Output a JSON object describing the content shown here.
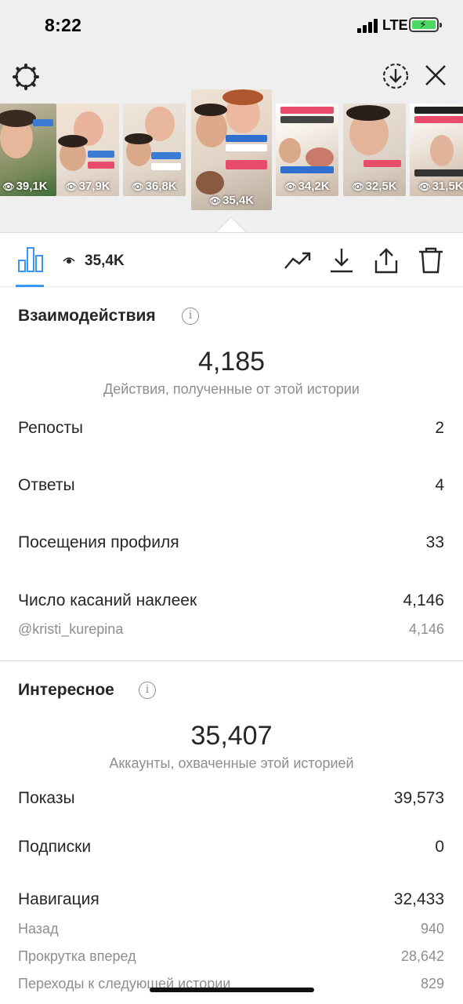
{
  "status_bar": {
    "time": "8:22",
    "network": "LTE"
  },
  "stories": [
    {
      "views": "39,1K",
      "selected": false
    },
    {
      "views": "37,9K",
      "selected": false
    },
    {
      "views": "36,8K",
      "selected": false
    },
    {
      "views": "35,4K",
      "selected": true,
      "sticker": "@kristi_kurepina"
    },
    {
      "views": "34,2K",
      "selected": false
    },
    {
      "views": "32,5K",
      "selected": false
    },
    {
      "views": "31,5K",
      "selected": false
    }
  ],
  "toolbar": {
    "views": "35,4K"
  },
  "interactions": {
    "title": "Взаимодействия",
    "total": "4,185",
    "subtitle": "Действия, полученные от этой истории",
    "rows": [
      {
        "label": "Репосты",
        "value": "2"
      },
      {
        "label": "Ответы",
        "value": "4"
      },
      {
        "label": "Посещения профиля",
        "value": "33"
      },
      {
        "label": "Число касаний наклеек",
        "value": "4,146"
      }
    ],
    "sub_rows": [
      {
        "label": "@kristi_kurepina",
        "value": "4,146"
      }
    ]
  },
  "discovery": {
    "title": "Интересное",
    "total": "35,407",
    "subtitle": "Аккаунты, охваченные этой историей",
    "rows": [
      {
        "label": "Показы",
        "value": "39,573"
      },
      {
        "label": "Подписки",
        "value": "0"
      },
      {
        "label": "Навигация",
        "value": "32,433"
      }
    ],
    "navigation_rows": [
      {
        "label": "Назад",
        "value": "940"
      },
      {
        "label": "Прокрутка вперед",
        "value": "28,642"
      },
      {
        "label": "Переходы к следующей истории",
        "value": "829"
      }
    ]
  },
  "icons": {
    "settings": "gear-icon",
    "download_all": "download-circle-icon",
    "close": "close-icon",
    "insights": "bar-chart-icon",
    "trend": "trend-icon",
    "download": "download-icon",
    "share": "share-icon",
    "delete": "trash-icon"
  },
  "colors": {
    "accent": "#3897f0",
    "battery": "#4cd964"
  }
}
